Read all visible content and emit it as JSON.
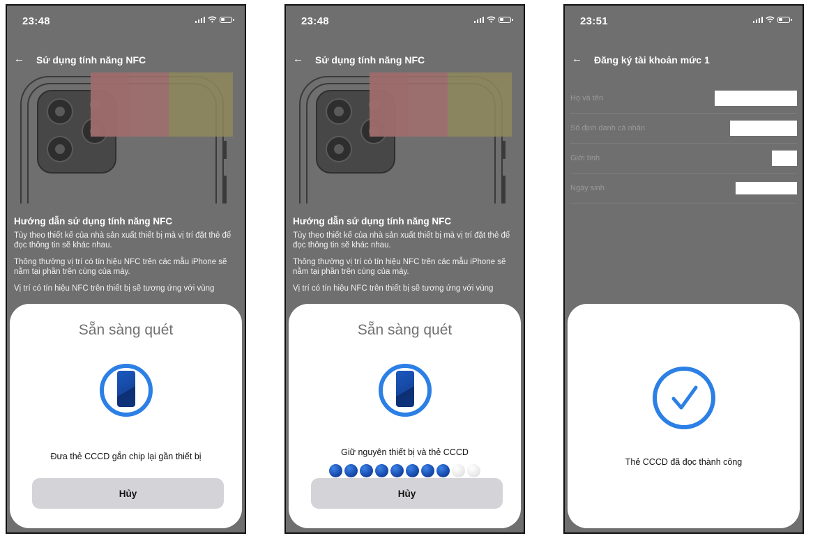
{
  "accent_color": "#2c7fe5",
  "screens": [
    {
      "status": {
        "time": "23:48"
      },
      "header": {
        "back_icon": "arrow-left-icon",
        "title": "Sử dụng tính năng NFC"
      },
      "guide": {
        "heading": "Hướng dẫn sử dụng tính năng NFC",
        "paragraphs": [
          "Tùy theo thiết kế của nhà sản xuất thiết bị mà vị trí đặt thẻ để đọc thông tin sẽ khác nhau.",
          "Thông thường vị trí có tín hiệu NFC trên các mẫu iPhone sẽ nằm tại phần trên cùng của máy.",
          "Vị trí có tín hiệu NFC trên thiết bị sẽ tương ứng với vùng"
        ]
      },
      "sheet": {
        "title": "Sẵn sàng quét",
        "icon": "phone-scan-icon",
        "message": "Đưa thẻ CCCD gắn chip lại gần thiết bị",
        "cancel_label": "Hủy"
      }
    },
    {
      "status": {
        "time": "23:48"
      },
      "header": {
        "back_icon": "arrow-left-icon",
        "title": "Sử dụng tính năng NFC"
      },
      "guide": {
        "heading": "Hướng dẫn sử dụng tính năng NFC",
        "paragraphs": [
          "Tùy theo thiết kế của nhà sản xuất thiết bị mà vị trí đặt thẻ để đọc thông tin sẽ khác nhau.",
          "Thông thường vị trí có tín hiệu NFC trên các mẫu iPhone sẽ nằm tại phần trên cùng của máy.",
          "Vị trí có tín hiệu NFC trên thiết bị sẽ tương ứng với vùng"
        ]
      },
      "sheet": {
        "title": "Sẵn sàng quét",
        "icon": "phone-scan-icon",
        "message": "Giữ nguyên thiết bị và thẻ CCCD",
        "progress": {
          "filled": 8,
          "total": 10
        },
        "cancel_label": "Hủy"
      }
    },
    {
      "status": {
        "time": "23:51"
      },
      "header": {
        "back_icon": "arrow-left-icon",
        "title": "Đăng ký tài khoản mức 1"
      },
      "form": {
        "fields": [
          {
            "label": "Họ và tên"
          },
          {
            "label": "Số định danh cá nhân"
          },
          {
            "label": "Giới tính"
          },
          {
            "label": "Ngày sinh"
          }
        ]
      },
      "sheet": {
        "icon": "checkmark-icon",
        "message": "Thẻ CCCD đã đọc thành công"
      }
    }
  ]
}
